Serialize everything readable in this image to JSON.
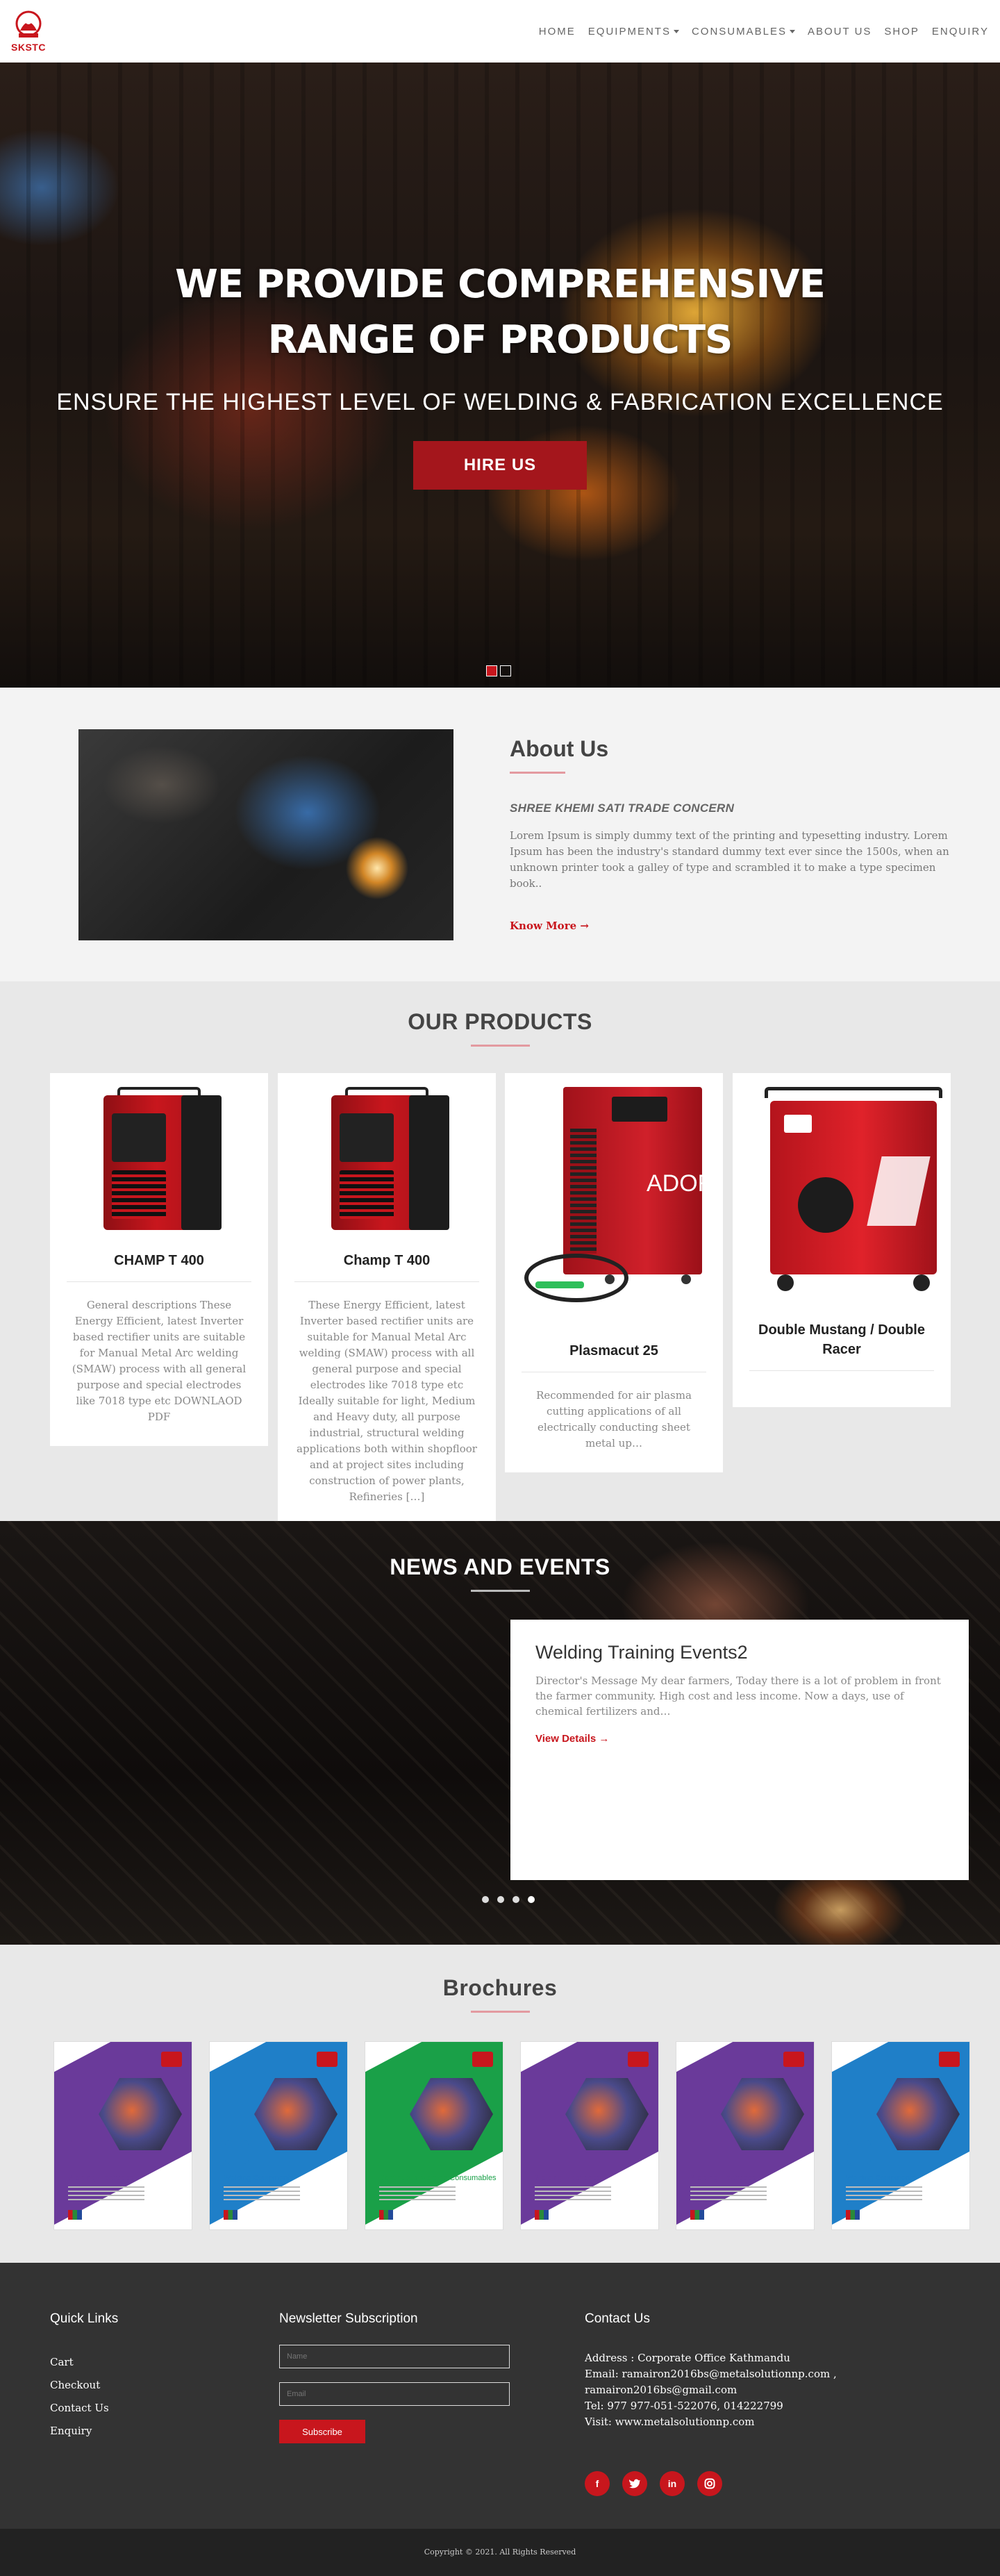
{
  "brand": {
    "logo_text": "SKSTC",
    "accent": "#c8161d"
  },
  "nav": {
    "items": [
      {
        "label": "HOME"
      },
      {
        "label": "EQUIPMENTS",
        "dropdown": true
      },
      {
        "label": "CONSUMABLES",
        "dropdown": true
      },
      {
        "label": "ABOUT US"
      },
      {
        "label": "SHOP"
      },
      {
        "label": "ENQUIRY"
      }
    ]
  },
  "hero": {
    "title": "WE PROVIDE COMPREHENSIVE RANGE OF PRODUCTS",
    "subtitle": "ENSURE THE HIGHEST LEVEL OF WELDING & FABRICATION EXCELLENCE",
    "button": "HIRE US"
  },
  "about": {
    "title": "About Us",
    "subtitle": "SHREE KHEMI SATI TRADE CONCERN",
    "body": "Lorem Ipsum is simply dummy text of the printing and typesetting industry. Lorem Ipsum has been the industry's standard dummy text ever since the 1500s, when an unknown printer took a galley of type and scrambled it to make a type specimen book..",
    "link": "Know More →"
  },
  "products": {
    "title": "OUR PRODUCTS",
    "items": [
      {
        "name": "CHAMP T 400",
        "desc": "General descriptions These Energy Efficient, latest Inverter based rectifier units are suitable for Manual Metal Arc welding (SMAW) process with all general purpose and special electrodes like 7018 type etc DOWNLAOD PDF"
      },
      {
        "name": "Champ T 400",
        "desc": "These Energy Efficient, latest Inverter based rectifier units are suitable for Manual Metal Arc welding (SMAW) process with all general purpose and special electrodes like 7018 type etc Ideally suitable for light, Medium and Heavy duty, all purpose industrial, structural welding applications both within shopfloor and at project sites including construction of power plants, Refineries […]"
      },
      {
        "name": "Plasmacut 25",
        "desc": "Recommended for air plasma cutting applications of all electrically conducting sheet metal up…",
        "image_text": "ADOR"
      },
      {
        "name": "Double Mustang / Double Racer",
        "desc": ""
      }
    ]
  },
  "news": {
    "title": "NEWS AND EVENTS",
    "card_title": "Welding Training Events2",
    "card_body": "Director's Message My dear farmers, Today there is a lot of problem in front the farmer community. High cost and less income. Now a days, use of chemical fertilizers and…",
    "link": "View Details →"
  },
  "brochures": {
    "title": "Brochures",
    "items": [
      {
        "label": "Welding Electrodes",
        "color": "#6a3a9a"
      },
      {
        "label": "Welding Equipments",
        "color": "#1f7fc8"
      },
      {
        "label": "Continuous Welding Consumables",
        "color": "#1aa048"
      },
      {
        "label": "Welding Electrodes",
        "color": "#6a3a9a"
      },
      {
        "label": "Welding Electrodes",
        "color": "#6a3a9a"
      },
      {
        "label": "Welding Equipments",
        "color": "#1f7fc8"
      }
    ]
  },
  "footer": {
    "quick_links_title": "Quick Links",
    "quick_links": [
      "Cart",
      "Checkout",
      "Contact Us",
      "Enquiry"
    ],
    "newsletter_title": "Newsletter Subscription",
    "name_placeholder": "Name",
    "email_placeholder": "Email",
    "subscribe": "Subscribe",
    "contact_title": "Contact Us",
    "contact_lines": [
      "Address : Corporate Office Kathmandu",
      "Email: ramairon2016bs@metalsolutionnp.com ,",
      "ramairon2016bs@gmail.com",
      "Tel: 977 977-051-522076, 014222799",
      "Visit: www.metalsolutionnp.com"
    ],
    "socials": [
      "facebook-icon",
      "twitter-icon",
      "linkedin-icon",
      "instagram-icon"
    ],
    "copyright": "Copyright © 2021. All Rights Reserved"
  }
}
